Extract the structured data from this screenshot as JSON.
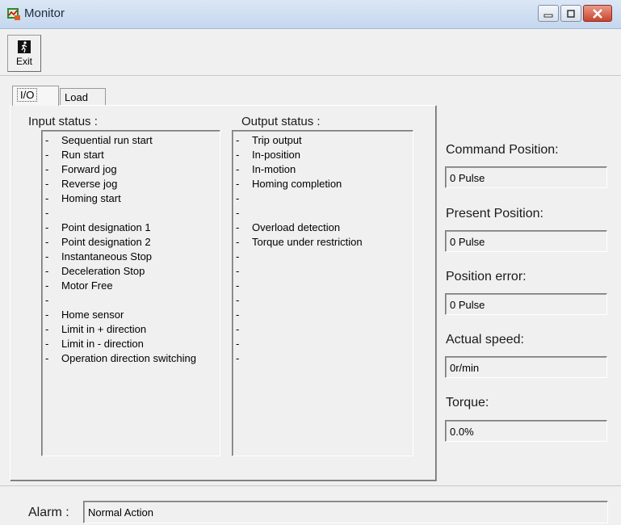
{
  "window": {
    "title": "Monitor"
  },
  "toolbar": {
    "exit_label": "Exit"
  },
  "tabs": [
    {
      "label": "I/O"
    },
    {
      "label": "Load"
    }
  ],
  "input_status": {
    "label": "Input status :",
    "items": [
      "Sequential run start",
      "Run start",
      "Forward jog",
      "Reverse jog",
      "Homing start",
      "",
      "Point designation 1",
      "Point designation 2",
      "Instantaneous Stop",
      "Deceleration Stop",
      "Motor Free",
      "",
      "Home sensor",
      "Limit in + direction",
      "Limit in - direction",
      "Operation direction switching"
    ]
  },
  "output_status": {
    "label": "Output status :",
    "items": [
      "Trip output",
      "In-position",
      "In-motion",
      "Homing completion",
      "",
      "",
      "Overload detection",
      "Torque under restriction",
      "",
      "",
      "",
      "",
      "",
      "",
      "",
      ""
    ]
  },
  "fields": {
    "command_position": {
      "label": "Command Position:",
      "value": "0 Pulse"
    },
    "present_position": {
      "label": "Present Position:",
      "value": "0 Pulse"
    },
    "position_error": {
      "label": "Position error:",
      "value": "0 Pulse"
    },
    "actual_speed": {
      "label": "Actual speed:",
      "value": "0r/min"
    },
    "torque": {
      "label": "Torque:",
      "value": "0.0%"
    }
  },
  "alarm": {
    "label": "Alarm :",
    "value": "Normal Action"
  },
  "icons": {
    "app": "monitor-app-icon",
    "exit": "exit-running-man-icon",
    "minimize": "minimize-icon",
    "maximize": "maximize-icon",
    "close": "close-icon"
  },
  "colors": {
    "close_button": "#c9452e",
    "background": "#f0f0f0"
  }
}
